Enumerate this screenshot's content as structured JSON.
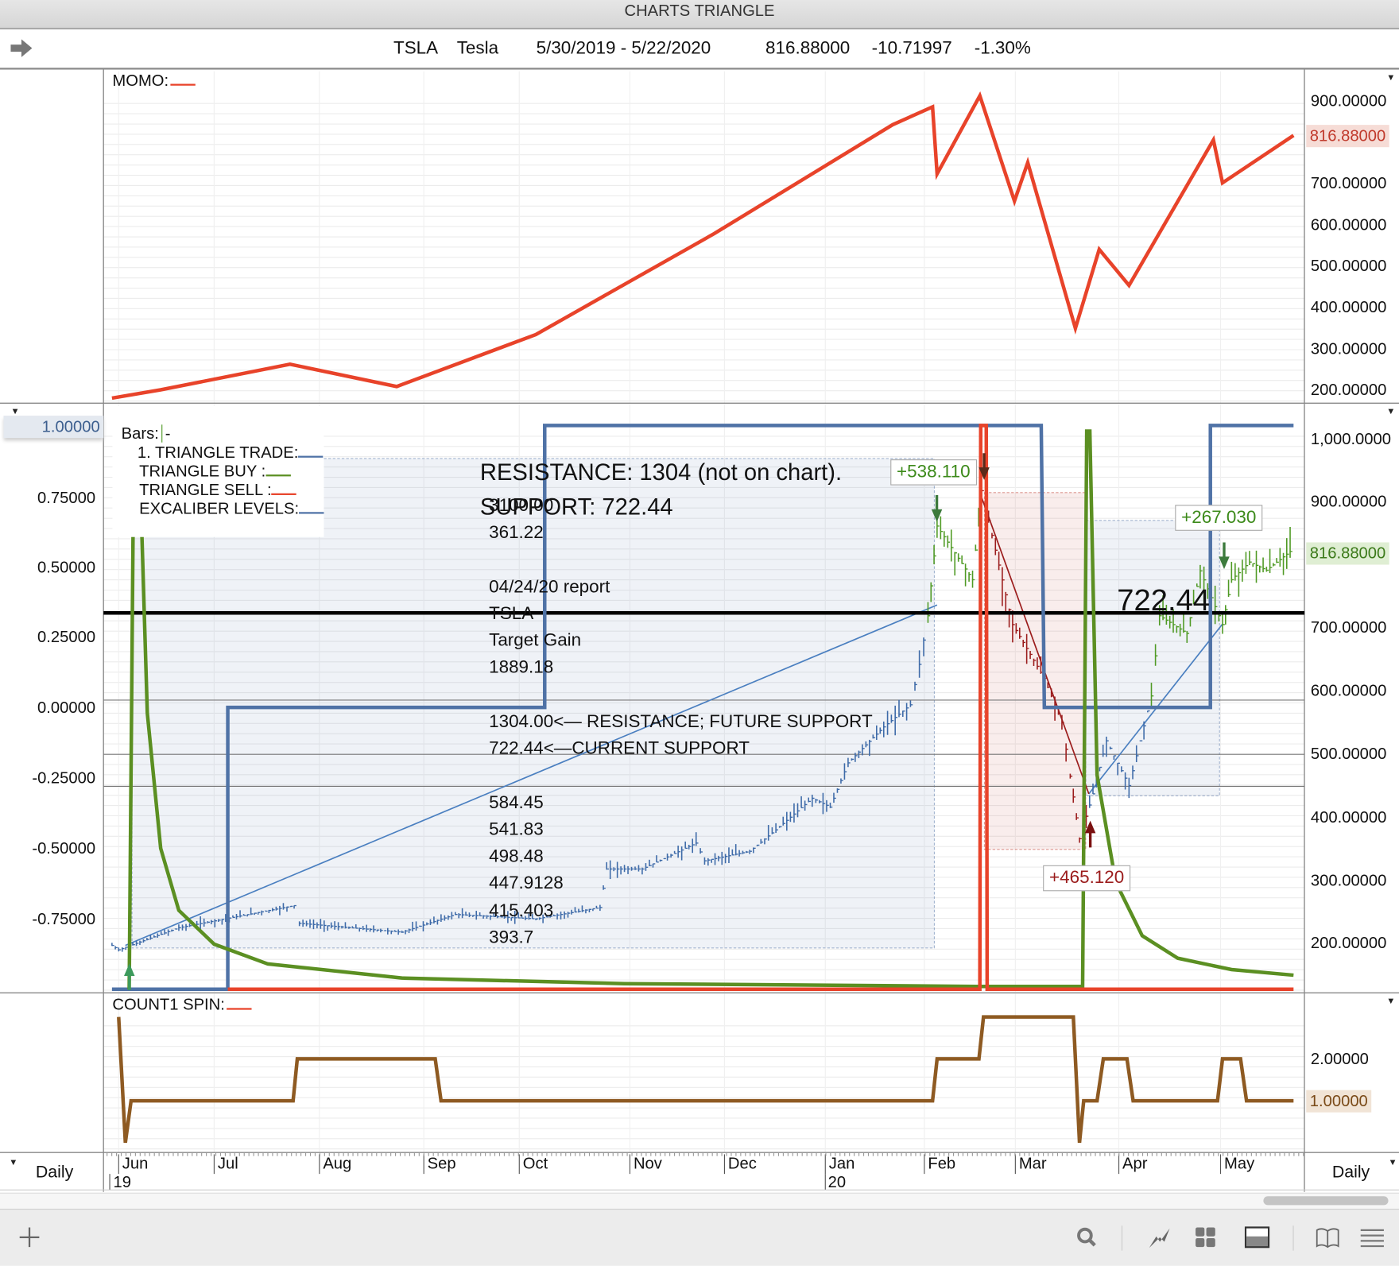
{
  "window": {
    "title": "CHARTS TRIANGLE"
  },
  "header": {
    "symbol": "TSLA",
    "name": "Tesla",
    "range": "5/30/2019 - 5/22/2020",
    "last": "816.88000",
    "change": "-10.71997",
    "pct": "-1.30%"
  },
  "panes": {
    "momo": {
      "label": "MOMO:",
      "color": "#e8432a",
      "right_ticks": [
        "900.00000",
        "700.00000",
        "600.00000",
        "500.00000",
        "400.00000",
        "300.00000",
        "200.00000"
      ],
      "current": "816.88000"
    },
    "price": {
      "bars_label": "Bars:",
      "bars_suffix": "-",
      "legend": [
        {
          "label": "1. TRIANGLE TRADE:",
          "color": "#4f72a6"
        },
        {
          "label": "TRIANGLE BUY :",
          "color": "#5b8f22"
        },
        {
          "label": "TRIANGLE SELL :",
          "color": "#e8432a"
        },
        {
          "label": "EXCALIBER LEVELS:",
          "color": "#4f72a6"
        }
      ],
      "left_ticks": [
        "1.00000",
        "0.75000",
        "0.50000",
        "0.25000",
        "0.00000",
        "-0.25000",
        "-0.50000",
        "-0.75000"
      ],
      "right_ticks": [
        "1,000.0000",
        "900.00000",
        "700.00000",
        "600.00000",
        "500.00000",
        "400.00000",
        "300.00000",
        "200.00000"
      ],
      "current": "816.88000"
    },
    "spin": {
      "label": "COUNT1 SPIN:",
      "color": "#8e5a22",
      "right_ticks": [
        "2.00000"
      ],
      "current": "1.00000"
    }
  },
  "annotations": {
    "resistance": "RESISTANCE: 1304 (not on chart).",
    "support": "SUPPORT: 722.44",
    "overlap": "3100.00",
    "lines": [
      "361.22",
      "04/24/20 report",
      "TSLA",
      "Target Gain",
      "1889.18",
      "1304.00<— RESISTANCE; FUTURE SUPPORT",
      "722.44<—CURRENT SUPPORT",
      "584.45",
      "541.83",
      "498.48",
      "447.9128",
      "415.403",
      "393.7"
    ],
    "big_level": "722.44",
    "gain1": "+538.110",
    "gain2": "+267.030",
    "loss1": "+465.120"
  },
  "xaxis": {
    "months": [
      "Jun",
      "Jul",
      "Aug",
      "Sep",
      "Oct",
      "Nov",
      "Dec",
      "Jan",
      "Feb",
      "Mar",
      "Apr",
      "May"
    ],
    "years": [
      "19",
      "20"
    ],
    "period_left": "Daily",
    "period_right": "Daily"
  },
  "chart_data": {
    "x_units": "months since Jun 2019",
    "momo": [
      [
        -0.07,
        180
      ],
      [
        0.44,
        200
      ],
      [
        1.72,
        262
      ],
      [
        2.74,
        208
      ],
      [
        4.15,
        334
      ],
      [
        5.89,
        578
      ],
      [
        7.68,
        842
      ],
      [
        8.09,
        885
      ],
      [
        8.14,
        723
      ],
      [
        8.61,
        912
      ],
      [
        8.99,
        657
      ],
      [
        9.12,
        750
      ],
      [
        9.58,
        349
      ],
      [
        9.81,
        540
      ],
      [
        10.1,
        453
      ],
      [
        10.93,
        805
      ],
      [
        11.02,
        701
      ],
      [
        11.73,
        816
      ]
    ],
    "price": [
      [
        -0.07,
        196
      ],
      [
        0,
        189
      ],
      [
        0.63,
        224
      ],
      [
        1.76,
        259
      ],
      [
        1.81,
        231
      ],
      [
        2.79,
        217
      ],
      [
        3.33,
        245
      ],
      [
        4.15,
        238
      ],
      [
        4.73,
        256
      ],
      [
        4.79,
        317
      ],
      [
        5.13,
        317
      ],
      [
        5.7,
        358
      ],
      [
        5.79,
        330
      ],
      [
        6.25,
        345
      ],
      [
        6.51,
        379
      ],
      [
        6.87,
        429
      ],
      [
        7.05,
        415
      ],
      [
        7.23,
        485
      ],
      [
        7.59,
        542
      ],
      [
        7.86,
        577
      ],
      [
        7.95,
        641
      ],
      [
        8.04,
        718
      ],
      [
        8.14,
        860
      ],
      [
        8.53,
        775
      ],
      [
        8.63,
        916
      ],
      [
        8.97,
        704
      ],
      [
        9.28,
        619
      ],
      [
        9.45,
        549
      ],
      [
        9.53,
        464
      ],
      [
        9.62,
        365
      ],
      [
        9.75,
        436
      ],
      [
        9.88,
        520
      ],
      [
        10.1,
        449
      ],
      [
        10.32,
        591
      ],
      [
        10.4,
        718
      ],
      [
        10.67,
        690
      ],
      [
        10.8,
        789
      ],
      [
        11.02,
        704
      ],
      [
        11.11,
        775
      ],
      [
        11.29,
        803
      ],
      [
        11.46,
        790
      ],
      [
        11.73,
        824
      ]
    ],
    "bar_colors": [
      [
        8.04,
        "#3d6aa8"
      ],
      [
        8.63,
        "#4f9a24"
      ],
      [
        9.69,
        "#9b1c1c"
      ],
      [
        10.32,
        "#3d6aa8"
      ],
      [
        99,
        "#4f9a24"
      ]
    ],
    "triangle_trade": [
      [
        -0.07,
        -1
      ],
      [
        1.13,
        -1
      ],
      [
        1.13,
        0
      ],
      [
        4.23,
        0
      ],
      [
        4.23,
        1
      ],
      [
        9.25,
        1
      ],
      [
        9.28,
        0
      ],
      [
        10.9,
        0
      ],
      [
        10.9,
        1
      ],
      [
        11.73,
        1
      ]
    ],
    "triangle_buy": [
      [
        0.11,
        -1
      ],
      [
        0.16,
        0.98
      ],
      [
        0.21,
        0.98
      ],
      [
        0.3,
        -0.02
      ],
      [
        0.44,
        -0.5
      ],
      [
        0.63,
        -0.72
      ],
      [
        1.0,
        -0.84
      ],
      [
        1.51,
        -0.91
      ],
      [
        2.79,
        -0.96
      ],
      [
        4.95,
        -0.98
      ],
      [
        8.58,
        -0.99
      ],
      [
        9.65,
        -0.99
      ],
      [
        9.69,
        0.98
      ],
      [
        9.72,
        0.98
      ],
      [
        9.79,
        -0.24
      ],
      [
        9.97,
        -0.62
      ],
      [
        10.23,
        -0.81
      ],
      [
        10.58,
        -0.89
      ],
      [
        11.11,
        -0.93
      ],
      [
        11.73,
        -0.95
      ]
    ],
    "triangle_sell": [
      [
        1.13,
        -1
      ],
      [
        8.61,
        -1
      ],
      [
        8.62,
        1
      ],
      [
        8.68,
        1
      ],
      [
        8.69,
        -1
      ],
      [
        11.73,
        -1
      ]
    ],
    "count1_spin": [
      [
        0,
        3
      ],
      [
        0.07,
        0
      ],
      [
        0.13,
        1
      ],
      [
        1.75,
        1
      ],
      [
        1.79,
        2
      ],
      [
        3.12,
        2
      ],
      [
        3.18,
        1
      ],
      [
        8.09,
        1
      ],
      [
        8.14,
        2
      ],
      [
        8.6,
        2
      ],
      [
        8.65,
        3
      ],
      [
        9.56,
        3
      ],
      [
        9.62,
        0
      ],
      [
        9.66,
        1
      ],
      [
        9.79,
        1
      ],
      [
        9.85,
        2
      ],
      [
        10.08,
        2
      ],
      [
        10.14,
        1
      ],
      [
        10.97,
        1
      ],
      [
        11.02,
        2
      ],
      [
        11.2,
        2
      ],
      [
        11.26,
        1
      ],
      [
        11.73,
        1
      ]
    ],
    "regressions": [
      {
        "from": [
          0.07,
          196
        ],
        "to": [
          8.14,
          735
        ],
        "color": "#4a7fc0"
      },
      {
        "from": [
          9.71,
          436
        ],
        "to": [
          11.02,
          705
        ],
        "color": "#4a7fc0"
      },
      {
        "from": [
          8.63,
          905
        ],
        "to": [
          9.71,
          436
        ],
        "color": "#9b1c1c"
      }
    ],
    "zones": [
      {
        "x": [
          0.14,
          8.11
        ],
        "y": [
          192,
          967
        ],
        "color": "#4f72a6"
      },
      {
        "x": [
          8.66,
          9.68
        ],
        "y": [
          348,
          913
        ],
        "color": "#c0392b"
      },
      {
        "x": [
          9.68,
          10.99
        ],
        "y": [
          433,
          869
        ],
        "color": "#4f72a6"
      }
    ],
    "support_level": 722.44,
    "levels": [
      584.45,
      498.48,
      447.9128
    ]
  }
}
